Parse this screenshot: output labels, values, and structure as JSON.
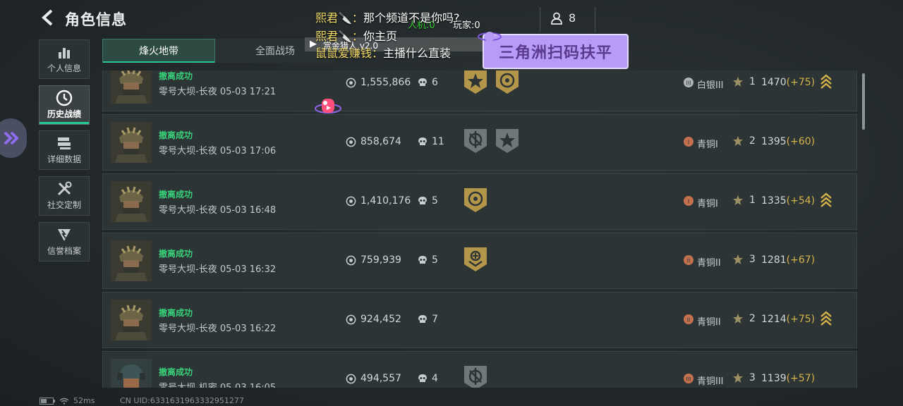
{
  "header": {
    "title": "角色信息",
    "friends_count": "8"
  },
  "nav": [
    {
      "label": "个人信息",
      "icon": "bar-chart-icon",
      "active": false
    },
    {
      "label": "历史战绩",
      "icon": "clock-icon",
      "active": true
    },
    {
      "label": "详细数据",
      "icon": "stack-icon",
      "active": false
    },
    {
      "label": "社交定制",
      "icon": "tools-icon",
      "active": false
    },
    {
      "label": "信誉档案",
      "icon": "shield-icon",
      "active": false
    }
  ],
  "tabs": [
    {
      "label": "烽火地带",
      "active": true
    },
    {
      "label": "全面战场",
      "active": false
    }
  ],
  "rows": [
    {
      "status": "撤离成功",
      "map": "零号大坝-长夜 05-03 17:21",
      "money": "1,555,866",
      "kills": "6",
      "badges": [
        "gold-star",
        "gold-coin"
      ],
      "rank_icon": "III",
      "rank_name": "白银III",
      "stars": "1",
      "score": "1470",
      "delta": "(+75)",
      "trend": true
    },
    {
      "status": "撤离成功",
      "map": "零号大坝-长夜 05-03 17:06",
      "money": "858,674",
      "kills": "11",
      "badges": [
        "grey-cross",
        "grey-star"
      ],
      "rank_icon": "I",
      "rank_name": "青铜I",
      "stars": "2",
      "score": "1395",
      "delta": "(+60)",
      "trend": false
    },
    {
      "status": "撤离成功",
      "map": "零号大坝-长夜 05-03 16:48",
      "money": "1,410,176",
      "kills": "5",
      "badges": [
        "gold-coin"
      ],
      "rank_icon": "I",
      "rank_name": "青铜I",
      "stars": "1",
      "score": "1335",
      "delta": "(+54)",
      "trend": true
    },
    {
      "status": "撤离成功",
      "map": "零号大坝-长夜 05-03 16:32",
      "money": "759,939",
      "kills": "5",
      "badges": [
        "gold-plus"
      ],
      "rank_icon": "II",
      "rank_name": "青铜II",
      "stars": "3",
      "score": "1281",
      "delta": "(+67)",
      "trend": false
    },
    {
      "status": "撤离成功",
      "map": "零号大坝-长夜 05-03 16:22",
      "money": "924,452",
      "kills": "7",
      "badges": [],
      "rank_icon": "II",
      "rank_name": "青铜II",
      "stars": "2",
      "score": "1214",
      "delta": "(+75)",
      "trend": true
    },
    {
      "status": "撤离成功",
      "map": "零号大坝-机密 05-03 16:05",
      "money": "494,557",
      "kills": "4",
      "badges": [
        "grey-cross"
      ],
      "rank_icon": "III",
      "rank_name": "青铜III",
      "stars": "3",
      "score": "1139",
      "delta": "(+57)",
      "trend": false
    }
  ],
  "footer": {
    "ping": "52ms",
    "uid": "CN UID:6331631963332951277"
  },
  "overlay": {
    "chat": [
      {
        "user": "熙君🔪：",
        "text": "那个频道不是你吗?"
      },
      {
        "user": "熙君🔪：",
        "text": "你主页"
      },
      {
        "user": "鼠鼠爱赚钱：",
        "text": "主播什么直装"
      }
    ],
    "bot_mode": "人机:0",
    "player_mode": "玩家:0",
    "mini_title": "赏金猎人 v2.0",
    "promo": "三角洲扫码扶平"
  },
  "colors": {
    "accent": "#28c89a",
    "success": "#39d27a",
    "gold": "#d5b34a"
  }
}
